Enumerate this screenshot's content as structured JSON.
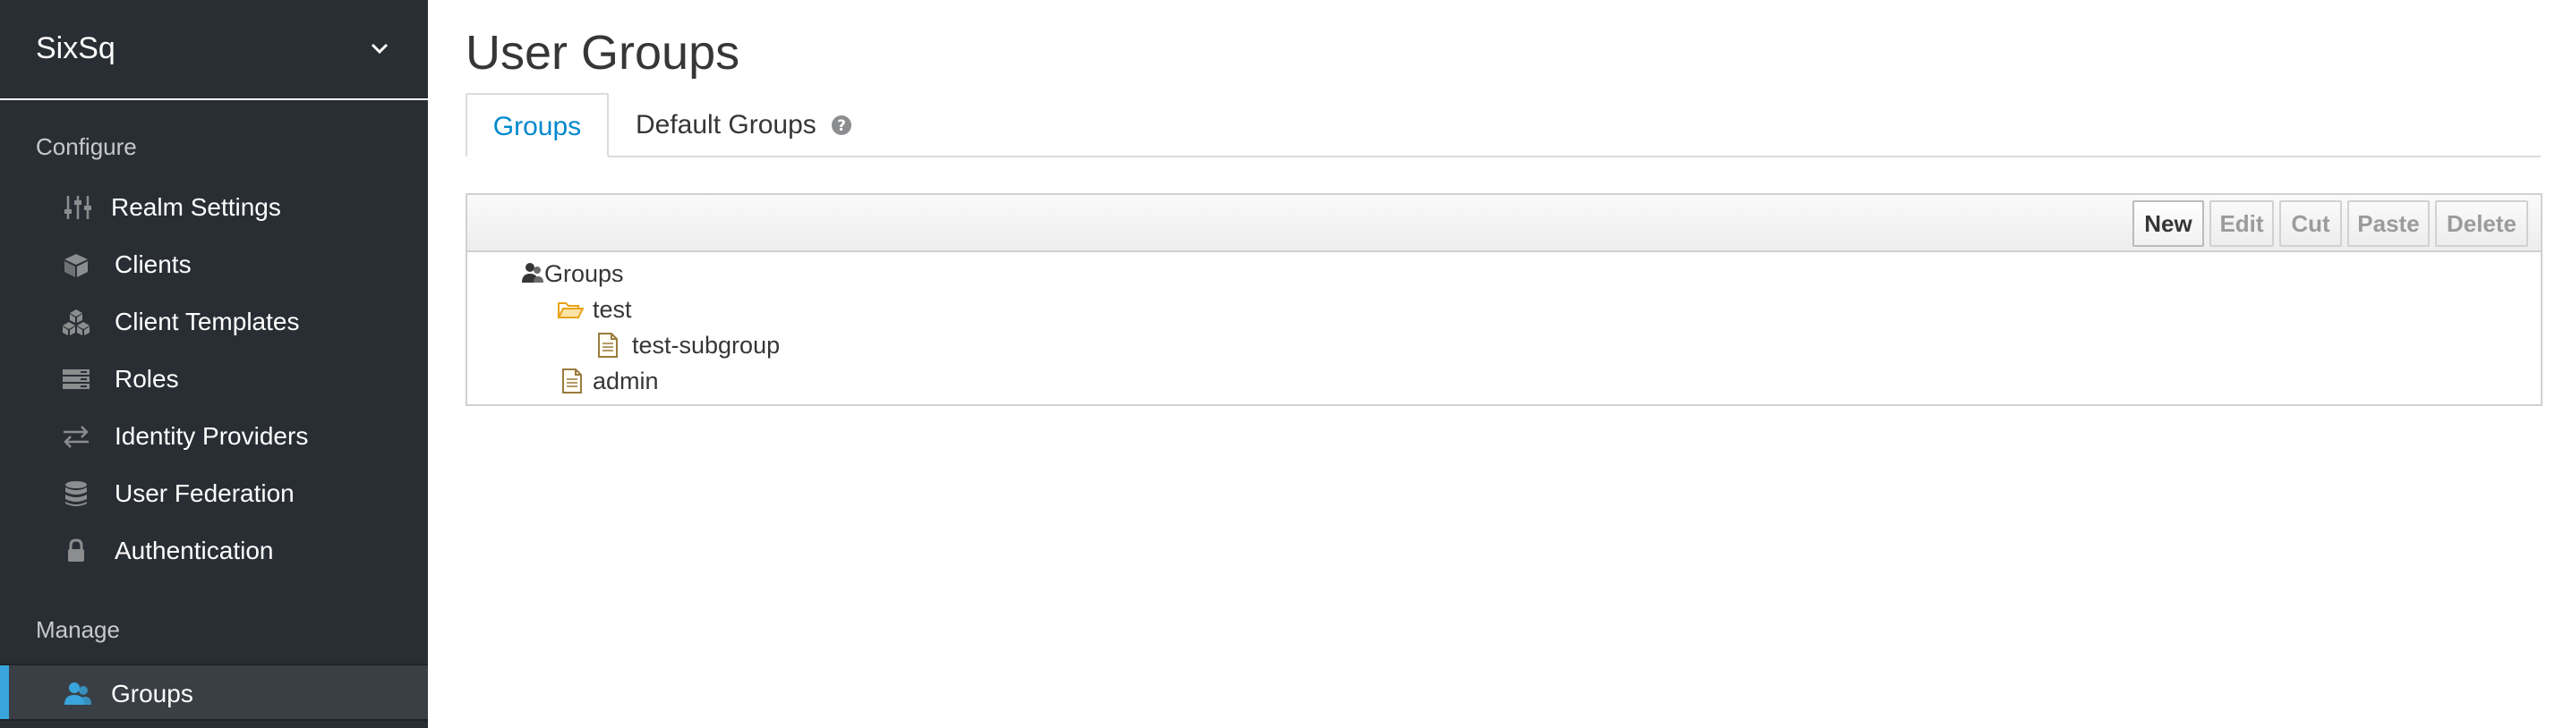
{
  "realm": {
    "name": "SixSq"
  },
  "sidebar": {
    "configure_title": "Configure",
    "configure_items": [
      {
        "label": "Realm Settings",
        "icon": "sliders-icon"
      },
      {
        "label": "Clients",
        "icon": "cube-icon"
      },
      {
        "label": "Client Templates",
        "icon": "cubes-icon"
      },
      {
        "label": "Roles",
        "icon": "list-icon"
      },
      {
        "label": "Identity Providers",
        "icon": "exchange-icon"
      },
      {
        "label": "User Federation",
        "icon": "database-icon"
      },
      {
        "label": "Authentication",
        "icon": "lock-icon"
      }
    ],
    "manage_title": "Manage",
    "manage_items": [
      {
        "label": "Groups",
        "icon": "users-icon",
        "active": true
      }
    ]
  },
  "main": {
    "title": "User Groups",
    "tabs": [
      {
        "label": "Groups",
        "active": true
      },
      {
        "label": "Default Groups",
        "active": false,
        "icon": "question-circle-icon"
      }
    ],
    "toolbar": {
      "buttons": [
        {
          "label": "New",
          "enabled": true
        },
        {
          "label": "Edit",
          "enabled": false
        },
        {
          "label": "Cut",
          "enabled": false
        },
        {
          "label": "Paste",
          "enabled": false
        },
        {
          "label": "Delete",
          "enabled": false
        }
      ]
    },
    "tree": {
      "root": {
        "label": "Groups",
        "icon": "users-icon"
      },
      "nodes": [
        {
          "label": "test",
          "icon": "folder-open-icon",
          "level": 1
        },
        {
          "label": "test-subgroup",
          "icon": "file-icon",
          "level": 2
        },
        {
          "label": "admin",
          "icon": "file-icon",
          "level": 1
        }
      ]
    }
  },
  "colors": {
    "sidebar_bg": "#292e34",
    "active_accent": "#39a5dc",
    "tab_active": "#0088ce",
    "folder": "#e8a317"
  }
}
